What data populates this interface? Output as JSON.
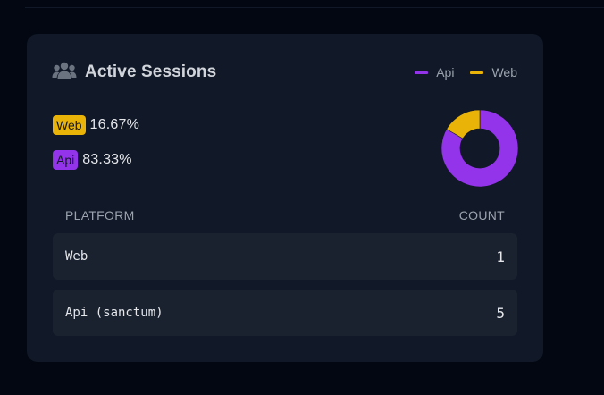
{
  "card": {
    "title": "Active Sessions",
    "icon": "users-icon"
  },
  "legend": [
    {
      "label": "Api",
      "color": "#9333ea"
    },
    {
      "label": "Web",
      "color": "#eab308"
    }
  ],
  "stats": [
    {
      "platform": "Web",
      "percent": "16.67%",
      "color": "#eab308",
      "text_color": "#111827"
    },
    {
      "platform": "Api",
      "percent": "83.33%",
      "color": "#9333ea",
      "text_color": "#111827"
    }
  ],
  "table": {
    "headers": {
      "platform": "PLATFORM",
      "count": "COUNT"
    },
    "rows": [
      {
        "platform": "Web",
        "count": "1"
      },
      {
        "platform": "Api (sanctum)",
        "count": "5"
      }
    ]
  },
  "chart_data": {
    "type": "pie",
    "categories": [
      "Api",
      "Web"
    ],
    "values": [
      5,
      1
    ],
    "colors": [
      "#9333ea",
      "#eab308"
    ],
    "donut": true
  }
}
